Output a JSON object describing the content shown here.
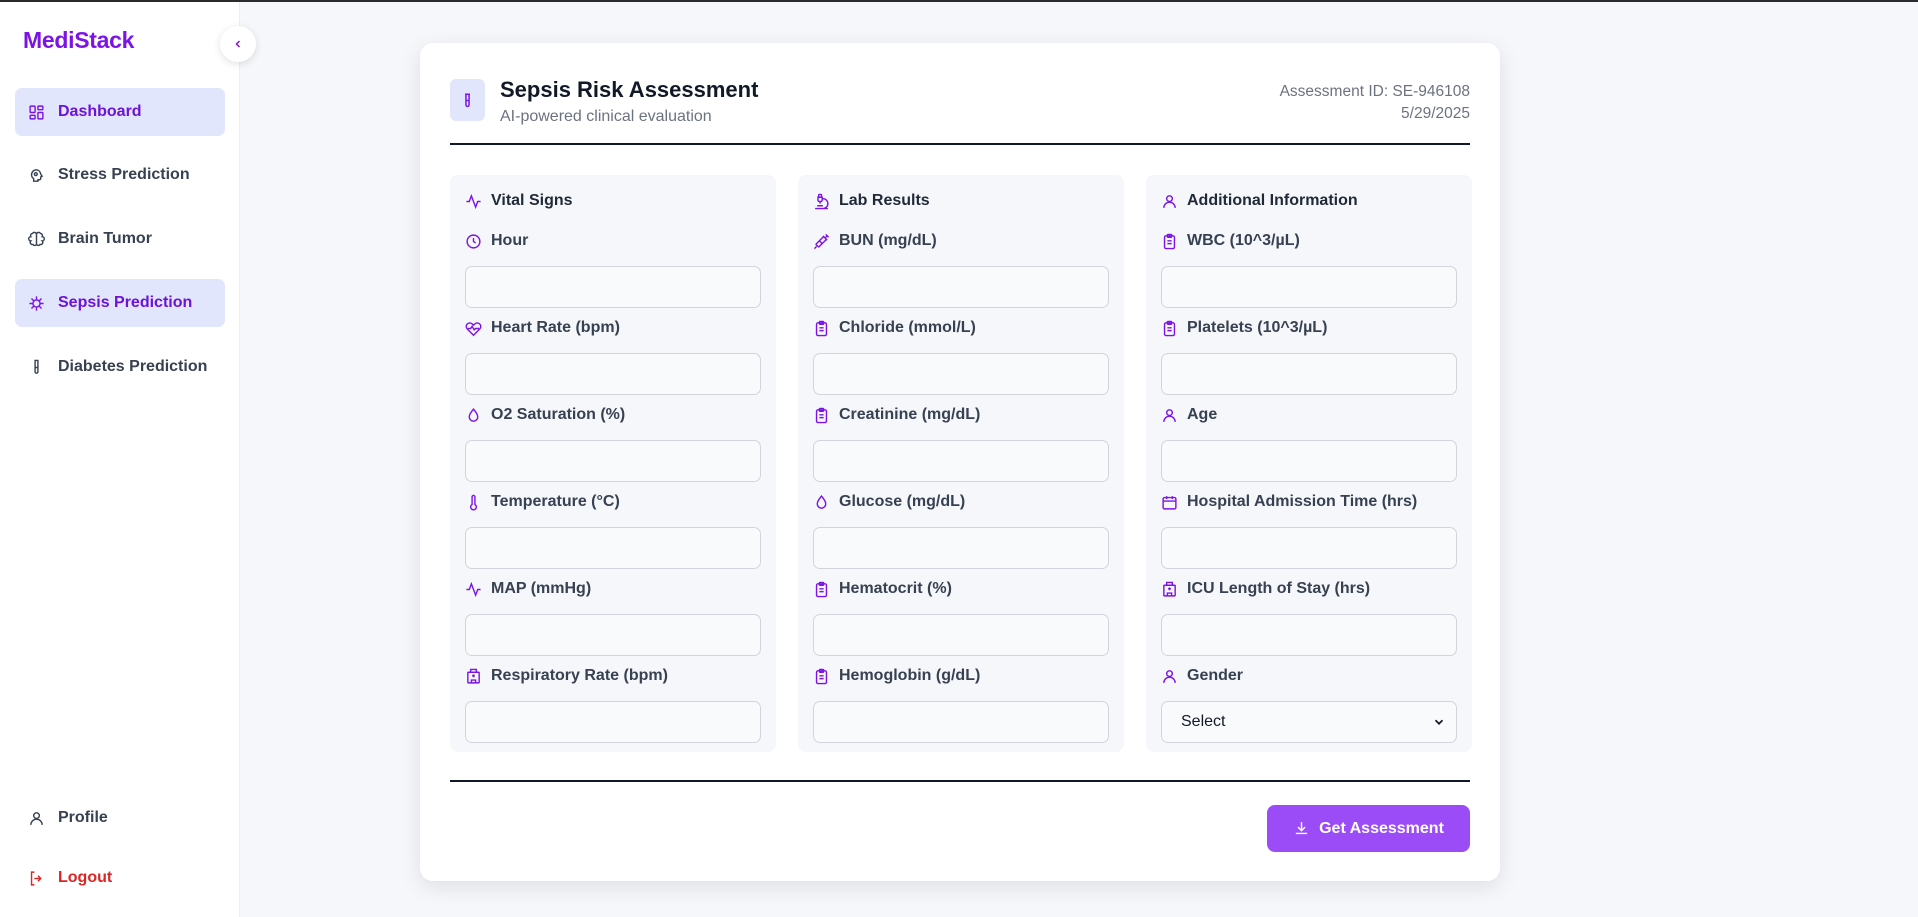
{
  "app": {
    "brand": "MediStack"
  },
  "sidebar": {
    "items": [
      {
        "label": "Dashboard",
        "icon": "dashboard-icon",
        "active": true
      },
      {
        "label": "Stress Prediction",
        "icon": "brain-outline-icon",
        "active": false
      },
      {
        "label": "Brain Tumor",
        "icon": "brain-icon",
        "active": false
      },
      {
        "label": "Sepsis Prediction",
        "icon": "virus-icon",
        "active": true
      },
      {
        "label": "Diabetes Prediction",
        "icon": "test-tube-icon",
        "active": false
      }
    ],
    "bottom": [
      {
        "label": "Profile",
        "icon": "user-icon"
      },
      {
        "label": "Logout",
        "icon": "logout-icon"
      }
    ]
  },
  "header": {
    "title": "Sepsis Risk Assessment",
    "subtitle": "AI-powered clinical evaluation",
    "assessment_id": "Assessment ID: SE-946108",
    "date": "5/29/2025"
  },
  "sections": [
    {
      "title": "Vital Signs",
      "fields": [
        {
          "label": "Hour",
          "value": ""
        },
        {
          "label": "Heart Rate (bpm)",
          "value": ""
        },
        {
          "label": "O2 Saturation (%)",
          "value": ""
        },
        {
          "label": "Temperature (°C)",
          "value": ""
        },
        {
          "label": "MAP (mmHg)",
          "value": ""
        },
        {
          "label": "Respiratory Rate (bpm)",
          "value": ""
        }
      ]
    },
    {
      "title": "Lab Results",
      "fields": [
        {
          "label": "BUN (mg/dL)",
          "value": ""
        },
        {
          "label": "Chloride (mmol/L)",
          "value": ""
        },
        {
          "label": "Creatinine (mg/dL)",
          "value": ""
        },
        {
          "label": "Glucose (mg/dL)",
          "value": ""
        },
        {
          "label": "Hematocrit (%)",
          "value": ""
        },
        {
          "label": "Hemoglobin (g/dL)",
          "value": ""
        }
      ]
    },
    {
      "title": "Additional Information",
      "fields": [
        {
          "label": "WBC (10^3/µL)",
          "value": ""
        },
        {
          "label": "Platelets (10^3/µL)",
          "value": ""
        },
        {
          "label": "Age",
          "value": ""
        },
        {
          "label": "Hospital Admission Time (hrs)",
          "value": ""
        },
        {
          "label": "ICU Length of Stay (hrs)",
          "value": ""
        },
        {
          "label": "Gender",
          "value": "Select"
        }
      ]
    }
  ],
  "actions": {
    "submit_label": "Get Assessment"
  },
  "colors": {
    "accent": "#7c14e6",
    "active_bg": "#e1e6fd",
    "button": "#9b4cf6",
    "logout": "#dc2626"
  }
}
